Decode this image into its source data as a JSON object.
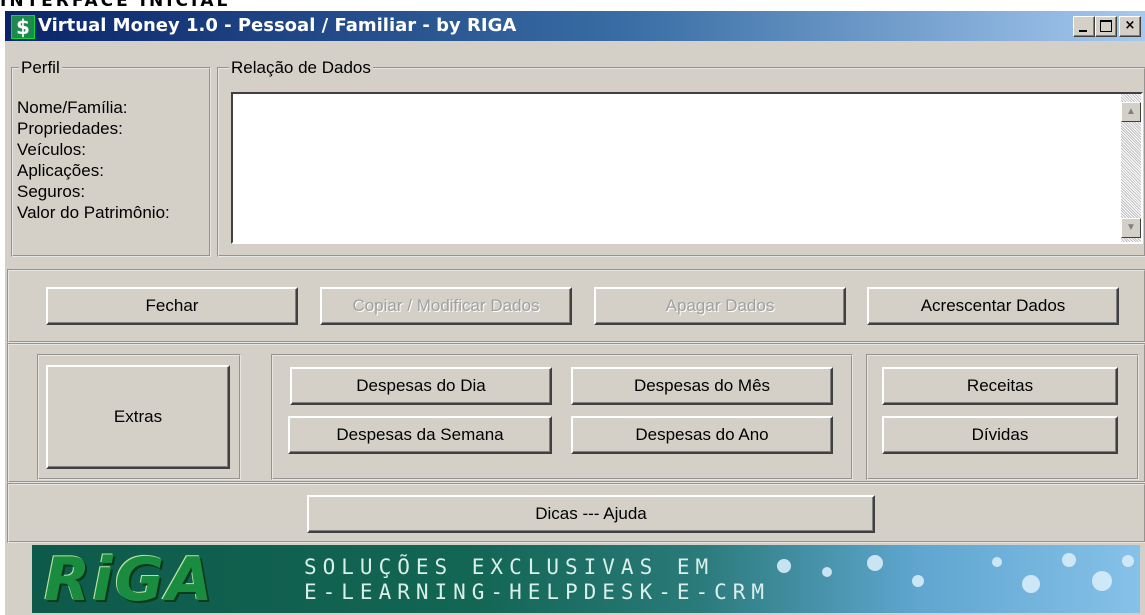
{
  "caption": "INTERFACE INICIAL",
  "window": {
    "title": "Virtual Money 1.0 - Pessoal / Familiar - by RIGA",
    "icon": "$",
    "controls": {
      "minimize": "",
      "maximize": "",
      "close": "×"
    }
  },
  "profile": {
    "legend": "Perfil",
    "lines": [
      "Nome/Família:",
      "Propriedades:",
      "Veículos:",
      "Aplicações:",
      "Seguros:",
      "Valor do Patrimônio:"
    ]
  },
  "data_list": {
    "legend": "Relação de Dados",
    "scroll_up": "▲",
    "scroll_down": "▼"
  },
  "actions": {
    "close": "Fechar",
    "copy_modify": "Copiar / Modificar Dados",
    "delete": "Apagar Dados",
    "add": "Acrescentar Dados"
  },
  "extras": "Extras",
  "expenses": {
    "day": "Despesas do Dia",
    "month": "Despesas do Mês",
    "week": "Despesas da Semana",
    "year": "Despesas do Ano"
  },
  "income": "Receitas",
  "debts": "Dívidas",
  "help": "Dicas --- Ajuda",
  "banner": {
    "logo": "RiGA",
    "line1": "SOLUÇÕES EXCLUSIVAS EM",
    "line2": "E-LEARNING-HELPDESK-E-CRM"
  }
}
